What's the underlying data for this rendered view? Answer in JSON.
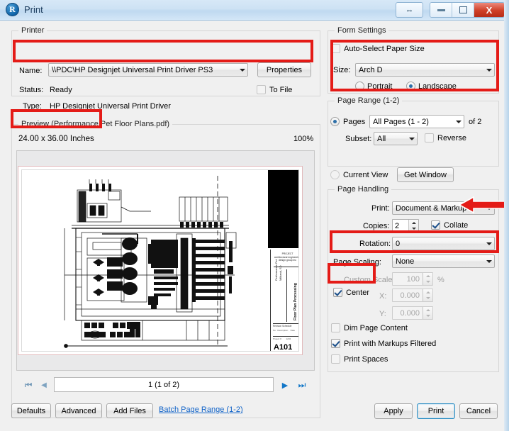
{
  "window": {
    "title": "Print",
    "app_icon": "revu-logo-icon",
    "controls": {
      "resize": "resize-arrow-icon",
      "minimize": "minimize-icon",
      "maximize": "restore-icon",
      "close": "X"
    }
  },
  "printer": {
    "legend": "Printer",
    "name_label": "Name:",
    "name_value": "\\\\PDC\\HP Designjet Universal Print Driver PS3",
    "properties_button": "Properties",
    "status_label": "Status:",
    "status_value": "Ready",
    "type_label": "Type:",
    "type_value": "HP Designjet Universal Print Driver",
    "to_file_label": "To File",
    "to_file_checked": false
  },
  "preview": {
    "legend": "Preview (Performance Pet Floor Plans.pdf)",
    "dimensions": "24.00 x  36.00 Inches",
    "zoom": "100%",
    "sheet_number": "A101",
    "title_block_line1": "Performance Pet",
    "title_block_line2": "Milbank, SD",
    "title_block_line3": "Floor Plan Processing"
  },
  "navigation": {
    "first_icon": "first-page-icon",
    "prev_icon": "previous-page-icon",
    "page_value": "1 (1 of 2)",
    "next_icon": "next-page-icon",
    "last_icon": "last-page-icon"
  },
  "footer": {
    "defaults": "Defaults",
    "advanced": "Advanced",
    "add_files": "Add Files",
    "batch_link": "Batch Page Range (1-2)",
    "apply": "Apply",
    "print": "Print",
    "cancel": "Cancel"
  },
  "form_settings": {
    "legend": "Form Settings",
    "auto_select_label": "Auto-Select Paper Size",
    "auto_select_checked": false,
    "size_label": "Size:",
    "size_value": "Arch D",
    "portrait_label": "Portrait",
    "landscape_label": "Landscape",
    "orientation_selected": "Landscape"
  },
  "page_range": {
    "legend": "Page Range (1-2)",
    "pages_label": "Pages",
    "pages_value": "All Pages (1 - 2)",
    "of_label": "of 2",
    "subset_label": "Subset:",
    "subset_value": "All",
    "reverse_label": "Reverse",
    "reverse_checked": false,
    "current_view_label": "Current View",
    "get_window_button": "Get Window",
    "selected": "Pages"
  },
  "page_handling": {
    "legend": "Page Handling",
    "print_label": "Print:",
    "print_value": "Document & Markup",
    "copies_label": "Copies:",
    "copies_value": "2",
    "collate_label": "Collate",
    "collate_checked": true,
    "rotation_label": "Rotation:",
    "rotation_value": "0",
    "page_scaling_label": "Page Scaling:",
    "page_scaling_value": "None",
    "custom_scale_label": "Custom Scale:",
    "custom_scale_value": "100",
    "percent_label": "%",
    "center_label": "Center",
    "center_checked": true,
    "x_label": "X:",
    "x_value": "0.000",
    "y_label": "Y:",
    "y_value": "0.000",
    "dim_page_label": "Dim Page Content",
    "dim_page_checked": false,
    "markups_label": "Print with Markups Filtered",
    "markups_checked": true,
    "print_spaces_label": "Print Spaces",
    "print_spaces_checked": false
  },
  "annotations": {
    "highlight_color": "#e41b17",
    "arrow": "left-arrow-annotation"
  }
}
